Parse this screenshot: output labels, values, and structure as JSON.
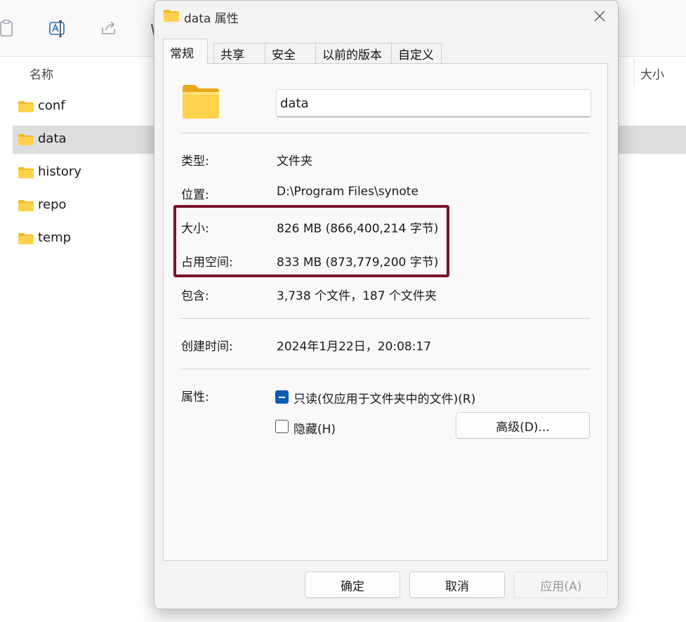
{
  "explorer": {
    "column_name": "名称",
    "column_size": "大小",
    "files": [
      {
        "name": "conf"
      },
      {
        "name": "data"
      },
      {
        "name": "history"
      },
      {
        "name": "repo"
      },
      {
        "name": "temp"
      }
    ]
  },
  "dialog": {
    "title": "data 属性",
    "tabs": [
      {
        "label": "常规"
      },
      {
        "label": "共享"
      },
      {
        "label": "安全"
      },
      {
        "label": "以前的版本"
      },
      {
        "label": "自定义"
      }
    ],
    "active_tab": "常规",
    "folder_name": "data",
    "type_label": "类型:",
    "type_value": "文件夹",
    "location_label": "位置:",
    "location_value": "D:\\Program Files\\synote",
    "size_label": "大小:",
    "size_value": "826 MB (866,400,214 字节)",
    "size_on_disk_label": "占用空间:",
    "size_on_disk_value": "833 MB (873,779,200 字节)",
    "contains_label": "包含:",
    "contains_value": "3,738 个文件，187 个文件夹",
    "created_label": "创建时间:",
    "created_value": "2024年1月22日，20:08:17",
    "attributes_label": "属性:",
    "readonly_label": "只读(仅应用于文件夹中的文件)(R)",
    "readonly_state": "mixed",
    "hidden_label": "隐藏(H)",
    "hidden_checked": false,
    "advanced_button": "高级(D)...",
    "ok_button": "确定",
    "cancel_button": "取消",
    "apply_button": "应用(A)",
    "highlight_color": "#7a1428",
    "accent_color": "#0a5bb5"
  }
}
